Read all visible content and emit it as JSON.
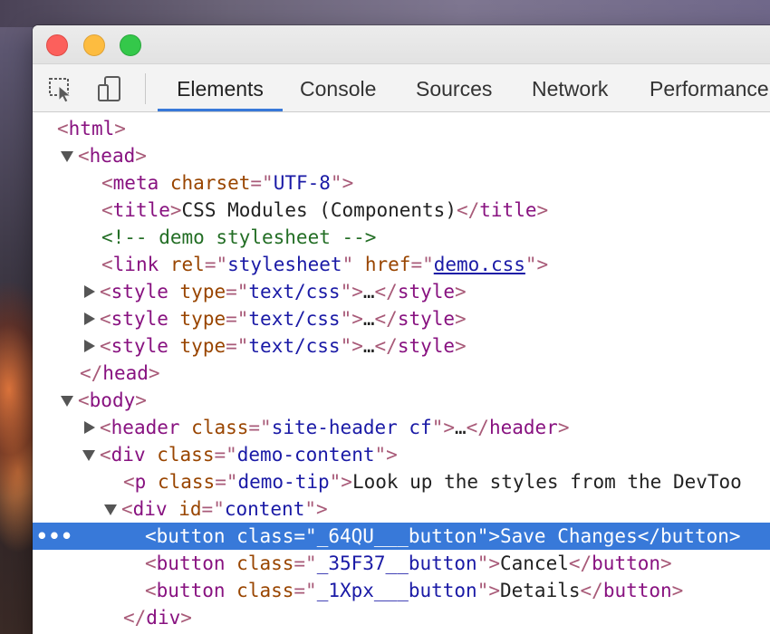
{
  "toolbar": {
    "icons": [
      "inspect-element-icon",
      "device-toolbar-icon"
    ],
    "tabs": [
      {
        "label": "Elements",
        "active": true
      },
      {
        "label": "Console",
        "active": false
      },
      {
        "label": "Sources",
        "active": false
      },
      {
        "label": "Network",
        "active": false
      },
      {
        "label": "Performance",
        "active": false
      }
    ]
  },
  "colors": {
    "accent": "#3879d9",
    "tag": "#881280",
    "attr_name": "#994500",
    "attr_value": "#1a1aa6",
    "comment": "#236e25"
  },
  "tree": {
    "html_open": "html",
    "head": "head",
    "meta": {
      "tag": "meta",
      "attr": "charset",
      "value": "UTF-8"
    },
    "title": {
      "tag": "title",
      "text": "CSS Modules (Components)"
    },
    "comment": "<!-- demo stylesheet -->",
    "link": {
      "tag": "link",
      "attr1": "rel",
      "value1": "stylesheet",
      "attr2": "href",
      "value2": "demo.css"
    },
    "styles": [
      {
        "tag": "style",
        "attr": "type",
        "value": "text/css",
        "ellipsis": "…"
      },
      {
        "tag": "style",
        "attr": "type",
        "value": "text/css",
        "ellipsis": "…"
      },
      {
        "tag": "style",
        "attr": "type",
        "value": "text/css",
        "ellipsis": "…"
      }
    ],
    "head_close": "head",
    "body": "body",
    "header": {
      "tag": "header",
      "attr": "class",
      "value": "site-header cf",
      "ellipsis": "…"
    },
    "div_demo": {
      "tag": "div",
      "attr": "class",
      "value": "demo-content"
    },
    "p_tip": {
      "tag": "p",
      "attr": "class",
      "value": "demo-tip",
      "text": "Look up the styles from the DevToo"
    },
    "div_content": {
      "tag": "div",
      "attr": "id",
      "value": "content"
    },
    "buttons": [
      {
        "tag": "button",
        "attr": "class",
        "value": "_64QU___button",
        "text": "Save Changes",
        "selected": true
      },
      {
        "tag": "button",
        "attr": "class",
        "value": "_35F37__button",
        "text": "Cancel",
        "selected": false
      },
      {
        "tag": "button",
        "attr": "class",
        "value": "_1Xpx___button",
        "text": "Details",
        "selected": false
      }
    ],
    "div_close": "div",
    "selected_marker": "•••"
  }
}
